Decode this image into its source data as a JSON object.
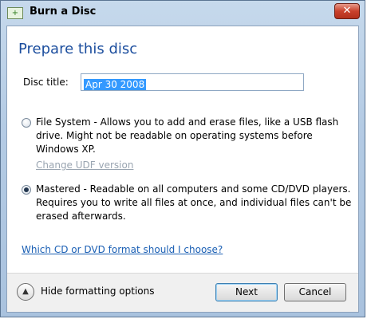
{
  "window": {
    "title": "Burn a Disc",
    "close_glyph": "✕"
  },
  "dialog": {
    "heading": "Prepare this disc",
    "disc_title_label": "Disc title:",
    "disc_title_value": "Apr 30 2008",
    "options": [
      {
        "label": "File System - Allows you to add and erase files, like a USB flash drive. Might not be readable on operating systems before Windows XP.",
        "checked": false
      },
      {
        "label": "Mastered - Readable on all computers and some CD/DVD players. Requires you to write all files at once, and individual files can't be erased afterwards.",
        "checked": true
      }
    ],
    "udf_link": "Change UDF version",
    "help_link": "Which CD or DVD format should I choose?"
  },
  "footer": {
    "toggle_icon": "chevron-up-icon",
    "toggle_label": "Hide formatting options",
    "next_label": "Next",
    "cancel_label": "Cancel"
  }
}
